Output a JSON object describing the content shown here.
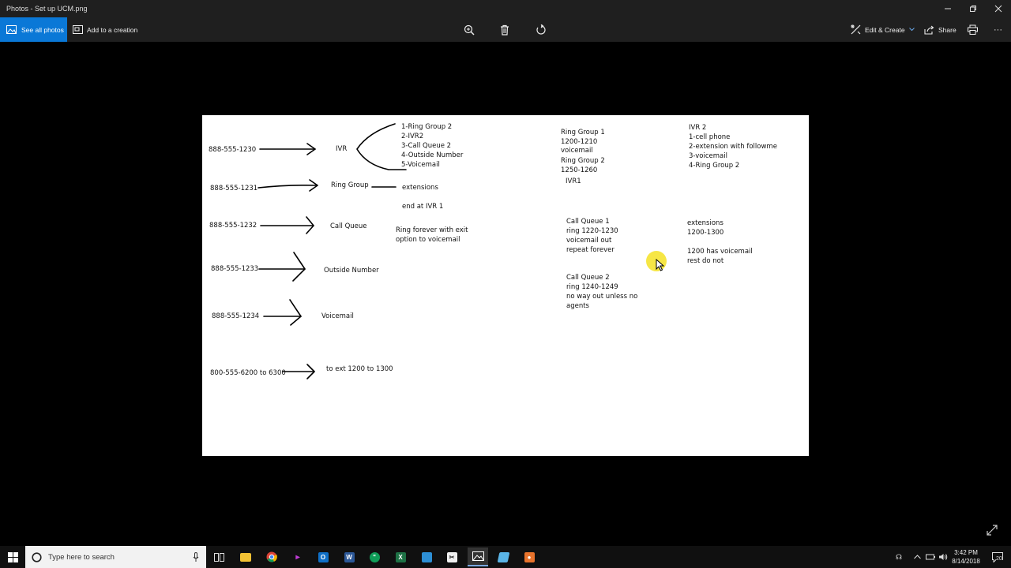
{
  "window": {
    "title": "Photos - Set up UCM.png"
  },
  "toolbar": {
    "see_all_label": "See all photos",
    "add_creation_label": "Add to a creation",
    "edit_create_label": "Edit & Create",
    "share_label": "Share",
    "more_label": "···"
  },
  "diagram": {
    "left_numbers": [
      "888-555-1230",
      "888-555-1231",
      "888-555-1232",
      "888-555-1233",
      "888-555-1234",
      "800-555-6200 to 6300"
    ],
    "destinations": [
      "IVR",
      "Ring Group",
      "Call Queue",
      "Outside Number",
      "Voicemail",
      "to ext 1200 to 1300"
    ],
    "ivr_options": [
      "1-Ring Group 2",
      "2-IVR2",
      "3-Call Queue 2",
      "4-Outside Number",
      "5-Voicemail"
    ],
    "ring_group_target": "extensions",
    "ring_group_note": "end at IVR 1",
    "call_queue_note_1": "Ring forever with exit",
    "call_queue_note_2": "option to voicemail",
    "rg1_lines": [
      "Ring Group 1",
      "1200-1210",
      "voicemail"
    ],
    "rg2_lines": [
      "Ring Group 2",
      "1250-1260"
    ],
    "ivr1_label": "IVR1",
    "ivr2_lines": [
      "IVR 2",
      "1-cell phone",
      "2-extension with followme",
      "3-voicemail",
      "4-Ring Group 2"
    ],
    "cq1_lines": [
      "Call Queue 1",
      "ring 1220-1230",
      "voicemail out",
      "repeat forever"
    ],
    "cq2_lines": [
      "Call Queue 2",
      "ring 1240-1249",
      "no way out unless no",
      "agents"
    ],
    "ext_lines": [
      "extensions",
      "1200-1300"
    ],
    "vm_lines": [
      "1200 has voicemail",
      "rest do not"
    ]
  },
  "taskbar": {
    "search_placeholder": "Type here to search",
    "time": "3:42 PM",
    "date": "8/14/2018",
    "notification_count": "20"
  },
  "colors": {
    "accent": "#0a78d7",
    "chrome_bg": "#1f1f1f",
    "highlight": "#f4e224"
  }
}
